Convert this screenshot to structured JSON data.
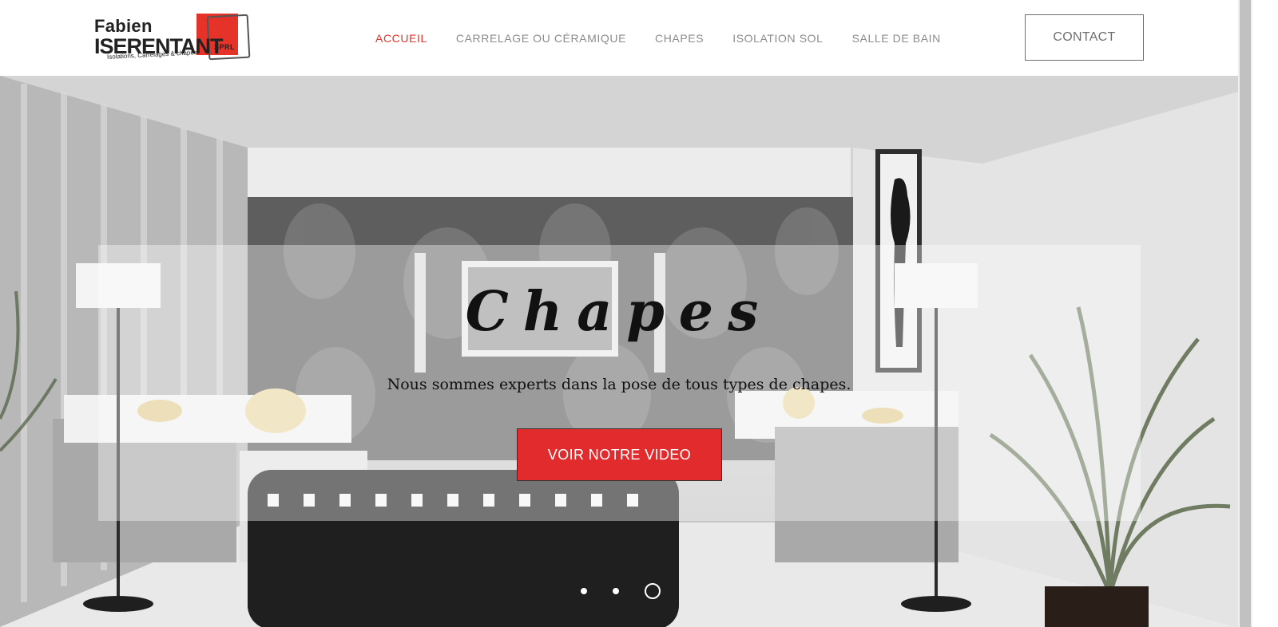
{
  "logo": {
    "first_name": "Fabien",
    "last_name": "ISERENTANT",
    "suffix": "SPRL",
    "tagline": "Isolations, Carrelages & chapes"
  },
  "nav": {
    "items": [
      {
        "label": "ACCUEIL",
        "active": true
      },
      {
        "label": "CARRELAGE OU CÉRAMIQUE",
        "active": false
      },
      {
        "label": "CHAPES",
        "active": false
      },
      {
        "label": "ISOLATION SOL",
        "active": false
      },
      {
        "label": "SALLE DE BAIN",
        "active": false
      }
    ],
    "contact_label": "CONTACT"
  },
  "hero": {
    "title": "Chapes",
    "subtitle": "Nous sommes experts dans la pose de tous types de chapes.",
    "cta_label": "VOIR NOTRE VIDEO",
    "slides_count": 3,
    "active_slide": 3
  },
  "colors": {
    "accent": "#e5332a",
    "button": "#e12b2d",
    "nav_text": "#8c8c8c"
  }
}
